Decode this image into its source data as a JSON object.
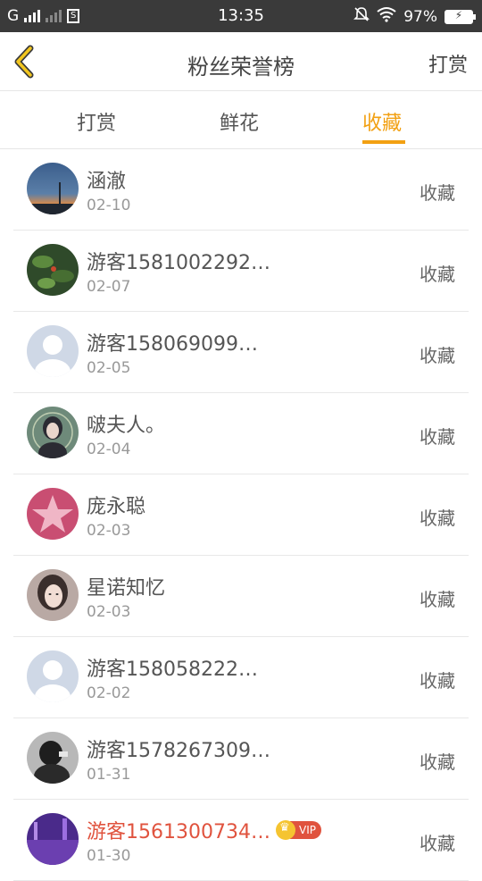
{
  "status": {
    "carrier": "G",
    "time": "13:35",
    "battery": "97%"
  },
  "nav": {
    "title": "粉丝荣誉榜",
    "action": "打赏"
  },
  "tabs": [
    {
      "label": "打赏",
      "active": false
    },
    {
      "label": "鲜花",
      "active": false
    },
    {
      "label": "收藏",
      "active": true
    }
  ],
  "rows": [
    {
      "name": "涵澈",
      "date": "02-10",
      "action": "收藏",
      "vip": false,
      "avatar": "sunset-avatar"
    },
    {
      "name": "游客1581002292…",
      "date": "02-07",
      "action": "收藏",
      "vip": false,
      "avatar": "leaf-avatar"
    },
    {
      "name": "游客158069099…",
      "date": "02-05",
      "action": "收藏",
      "vip": false,
      "avatar": "default-avatar"
    },
    {
      "name": "啵夫人。",
      "date": "02-04",
      "action": "收藏",
      "vip": false,
      "avatar": "girl-avatar"
    },
    {
      "name": "庞永聪",
      "date": "02-03",
      "action": "收藏",
      "vip": false,
      "avatar": "star-avatar"
    },
    {
      "name": "星诺知忆",
      "date": "02-03",
      "action": "收藏",
      "vip": false,
      "avatar": "portrait-avatar"
    },
    {
      "name": "游客158058222…",
      "date": "02-02",
      "action": "收藏",
      "vip": false,
      "avatar": "default-avatar"
    },
    {
      "name": "游客1578267309…",
      "date": "01-31",
      "action": "收藏",
      "vip": false,
      "avatar": "dark-avatar"
    },
    {
      "name": "游客1561300734…",
      "date": "01-30",
      "action": "收藏",
      "vip": true,
      "vip_label": "VIP",
      "avatar": "purple-avatar"
    }
  ],
  "colors": {
    "accent": "#f2a012",
    "vip": "#e0533e"
  }
}
